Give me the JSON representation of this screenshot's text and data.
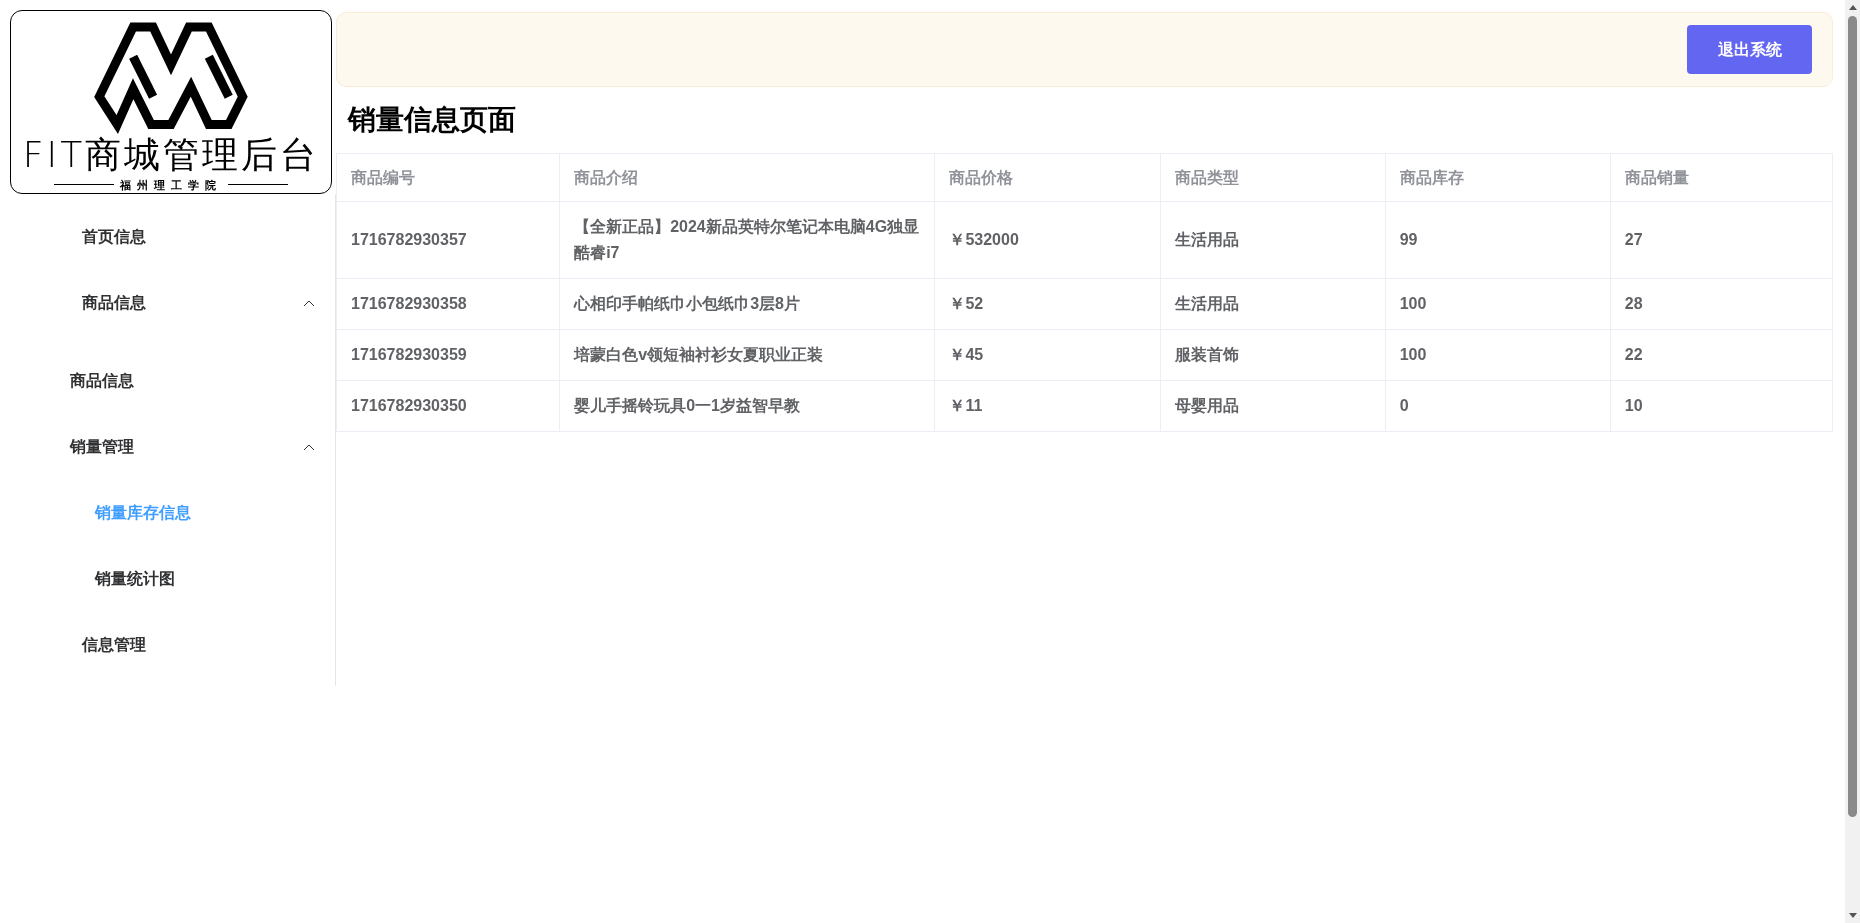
{
  "logo": {
    "title": "FIT商城管理后台",
    "subtitle": "福州理工学院"
  },
  "sidebar": {
    "items": [
      {
        "label": "首页信息",
        "selected": false
      },
      {
        "label": "商品信息",
        "selected": false,
        "expanded": true,
        "children": [
          {
            "label": "商品信息",
            "selected": false
          },
          {
            "label": "销量管理",
            "selected": false,
            "expanded": true,
            "children": [
              {
                "label": "销量库存信息",
                "selected": true
              },
              {
                "label": "销量统计图",
                "selected": false
              }
            ]
          }
        ]
      },
      {
        "label": "信息管理",
        "selected": false
      }
    ]
  },
  "header": {
    "logout_button": "退出系统"
  },
  "page_title": "销量信息页面",
  "table": {
    "columns": [
      "商品编号",
      "商品介绍",
      "商品价格",
      "商品类型",
      "商品库存",
      "商品销量"
    ],
    "rows": [
      [
        "1716782930357",
        "【全新正品】2024新品英特尔笔记本电脑4G独显酷睿i7",
        "￥532000",
        "生活用品",
        "99",
        "27"
      ],
      [
        "1716782930358",
        "心相印手帕纸巾小包纸巾3层8片",
        "￥52",
        "生活用品",
        "100",
        "28"
      ],
      [
        "1716782930359",
        "培蒙白色v领短袖衬衫女夏职业正装",
        "￥45",
        "服装首饰",
        "100",
        "22"
      ],
      [
        "1716782930350",
        "婴儿手摇铃玩具0一1岁益智早教",
        "￥11",
        "母婴用品",
        "0",
        "10"
      ]
    ]
  }
}
